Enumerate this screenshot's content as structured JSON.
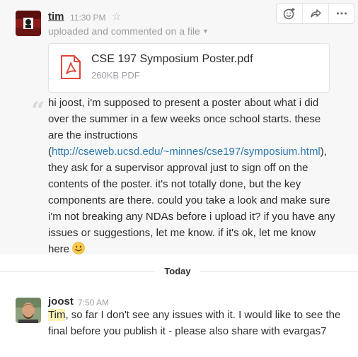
{
  "message1": {
    "author": "tim",
    "time": "11:30 PM",
    "subtitle": "uploaded and commented on a file",
    "file": {
      "name": "CSE 197 Symposium Poster.pdf",
      "meta": "260KB PDF"
    },
    "comment_before_link": "hi joost, i'm supposed to present a poster about what i did over the summer in a few weeks once school starts. these are the instructions (",
    "link": "http://cseweb.ucsd.edu/~minnes/cse197/symposium.html",
    "comment_after_link": "), they ask for a supervisor approval just to sign off on the contents of the poster. it's not totally done, but the key components are there. could you take a look and make sure i'm not breaking any NDAs before i upload it? if you have any issues or suggestions, let me know. if it's ok, let me know here "
  },
  "divider": {
    "label": "Today"
  },
  "message2": {
    "author": "joost",
    "time": "7:50 AM",
    "mention": "Tim",
    "text": ", so far I don't see any issues with it. I would like to see the final before you publish it - please also share with evargas7"
  },
  "colors": {
    "link": "#2d7ab0",
    "mention_bg": "#fbf2b7",
    "muted": "#9e9ea6"
  }
}
